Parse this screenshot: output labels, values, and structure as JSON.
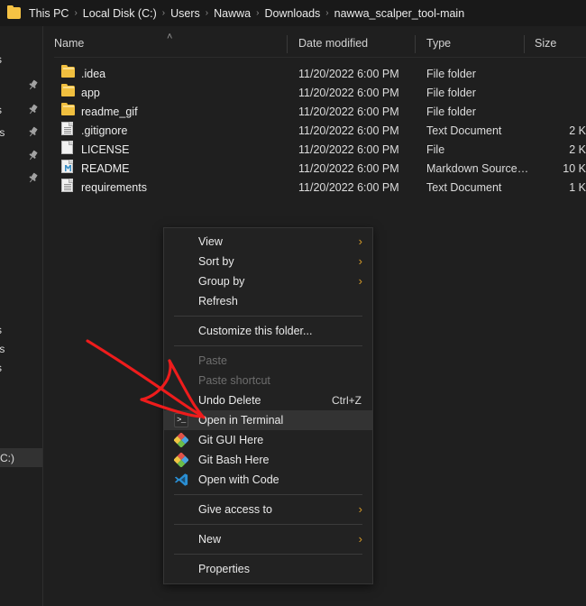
{
  "window": {
    "background_color": "#1f1f1f",
    "accent_chevron_color": "#d79b28"
  },
  "addressbar": {
    "folder_icon": "folder-icon",
    "crumbs": [
      {
        "label": "This PC"
      },
      {
        "label": "Local Disk (C:)"
      },
      {
        "label": "Users"
      },
      {
        "label": "Nawwa"
      },
      {
        "label": "Downloads"
      },
      {
        "label": "nawwa_scalper_tool-main"
      }
    ],
    "separator": "›"
  },
  "navpane": {
    "items": [
      {
        "label": "s",
        "pin": false,
        "selected": false
      },
      {
        "label": "",
        "pin": true,
        "selected": false
      },
      {
        "label": "s",
        "pin": true,
        "selected": false
      },
      {
        "label": "ts",
        "pin": true,
        "selected": false
      },
      {
        "label": "",
        "pin": true,
        "selected": false
      },
      {
        "label": "",
        "pin": true,
        "selected": false
      },
      {
        "label": "s",
        "pin": false,
        "selected": false
      },
      {
        "label": "ts",
        "pin": false,
        "selected": false
      },
      {
        "label": "s",
        "pin": false,
        "selected": false
      },
      {
        "label": "(C:)",
        "pin": false,
        "selected": true
      }
    ]
  },
  "filelist": {
    "columns": [
      {
        "label": "Name"
      },
      {
        "label": "Date modified"
      },
      {
        "label": "Type"
      },
      {
        "label": "Size"
      }
    ],
    "sort_indicator": "˄",
    "rows": [
      {
        "name": ".idea",
        "icon": "folder-icon",
        "date": "11/20/2022 6:00 PM",
        "type": "File folder",
        "size": ""
      },
      {
        "name": "app",
        "icon": "folder-icon",
        "date": "11/20/2022 6:00 PM",
        "type": "File folder",
        "size": ""
      },
      {
        "name": "readme_gif",
        "icon": "folder-icon",
        "date": "11/20/2022 6:00 PM",
        "type": "File folder",
        "size": ""
      },
      {
        "name": ".gitignore",
        "icon": "text-document-icon",
        "date": "11/20/2022 6:00 PM",
        "type": "Text Document",
        "size": "2 K"
      },
      {
        "name": "LICENSE",
        "icon": "blank-file-icon",
        "date": "11/20/2022 6:00 PM",
        "type": "File",
        "size": "2 K"
      },
      {
        "name": "README",
        "icon": "markdown-file-icon",
        "date": "11/20/2022 6:00 PM",
        "type": "Markdown Source…",
        "size": "10 K"
      },
      {
        "name": "requirements",
        "icon": "text-document-icon",
        "date": "11/20/2022 6:00 PM",
        "type": "Text Document",
        "size": "1 K"
      }
    ]
  },
  "contextmenu": {
    "items": [
      {
        "label": "View",
        "icon": null,
        "submenu": true,
        "disabled": false,
        "accel": "",
        "hover": false,
        "sep_after": false
      },
      {
        "label": "Sort by",
        "icon": null,
        "submenu": true,
        "disabled": false,
        "accel": "",
        "hover": false,
        "sep_after": false
      },
      {
        "label": "Group by",
        "icon": null,
        "submenu": true,
        "disabled": false,
        "accel": "",
        "hover": false,
        "sep_after": false
      },
      {
        "label": "Refresh",
        "icon": null,
        "submenu": false,
        "disabled": false,
        "accel": "",
        "hover": false,
        "sep_after": true
      },
      {
        "label": "Customize this folder...",
        "icon": null,
        "submenu": false,
        "disabled": false,
        "accel": "",
        "hover": false,
        "sep_after": true
      },
      {
        "label": "Paste",
        "icon": null,
        "submenu": false,
        "disabled": true,
        "accel": "",
        "hover": false,
        "sep_after": false
      },
      {
        "label": "Paste shortcut",
        "icon": null,
        "submenu": false,
        "disabled": true,
        "accel": "",
        "hover": false,
        "sep_after": false
      },
      {
        "label": "Undo Delete",
        "icon": null,
        "submenu": false,
        "disabled": false,
        "accel": "Ctrl+Z",
        "hover": false,
        "sep_after": false
      },
      {
        "label": "Open in Terminal",
        "icon": "terminal-icon",
        "submenu": false,
        "disabled": false,
        "accel": "",
        "hover": true,
        "sep_after": false
      },
      {
        "label": "Git GUI Here",
        "icon": "git-icon",
        "submenu": false,
        "disabled": false,
        "accel": "",
        "hover": false,
        "sep_after": false
      },
      {
        "label": "Git Bash Here",
        "icon": "git-icon",
        "submenu": false,
        "disabled": false,
        "accel": "",
        "hover": false,
        "sep_after": false
      },
      {
        "label": "Open with Code",
        "icon": "vscode-icon",
        "submenu": false,
        "disabled": false,
        "accel": "",
        "hover": false,
        "sep_after": true
      },
      {
        "label": "Give access to",
        "icon": null,
        "submenu": true,
        "disabled": false,
        "accel": "",
        "hover": false,
        "sep_after": true
      },
      {
        "label": "New",
        "icon": null,
        "submenu": true,
        "disabled": false,
        "accel": "",
        "hover": false,
        "sep_after": true
      },
      {
        "label": "Properties",
        "icon": null,
        "submenu": false,
        "disabled": false,
        "accel": "",
        "hover": false,
        "sep_after": false
      }
    ],
    "submenu_chevron": "›"
  },
  "annotation": {
    "color": "#ee1c1c",
    "shape": "hand-drawn-arrow",
    "points_to": "Open in Terminal"
  }
}
